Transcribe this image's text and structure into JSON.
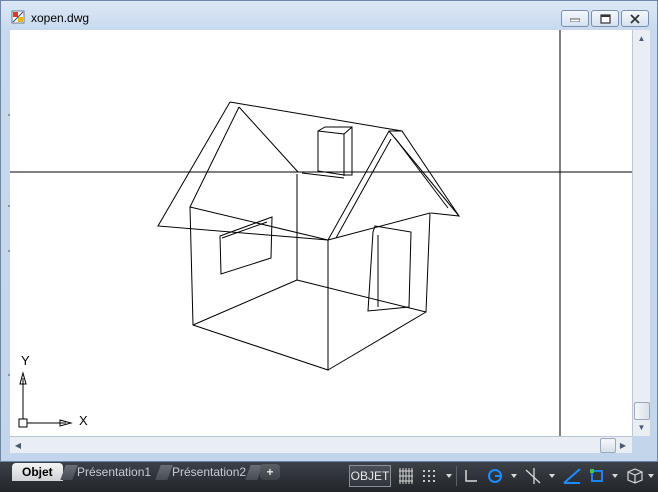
{
  "window": {
    "title": "xopen.dwg",
    "buttons": [
      "minimize",
      "restore",
      "close"
    ]
  },
  "viewport": {
    "background": "#ffffff",
    "ucs": {
      "y_label": "Y",
      "x_label": "X"
    }
  },
  "statusbar": {
    "tabs": [
      {
        "label": "Objet",
        "active": true
      },
      {
        "label": "Présentation1",
        "active": false
      },
      {
        "label": "Présentation2",
        "active": false
      }
    ],
    "add_tab": "+",
    "model_label": "OBJET",
    "tools": [
      "grid-icon",
      "snap-icon",
      "ortho-icon",
      "polar-icon",
      "osnap-tracking-icon",
      "isodraft-icon",
      "dynamic-ucs-icon",
      "object-snap-icon",
      "3d-view-icon"
    ]
  },
  "colors": {
    "accent": "#1e8bff",
    "statusbar": "#2b2f35",
    "frame": "#c8d9ee"
  }
}
